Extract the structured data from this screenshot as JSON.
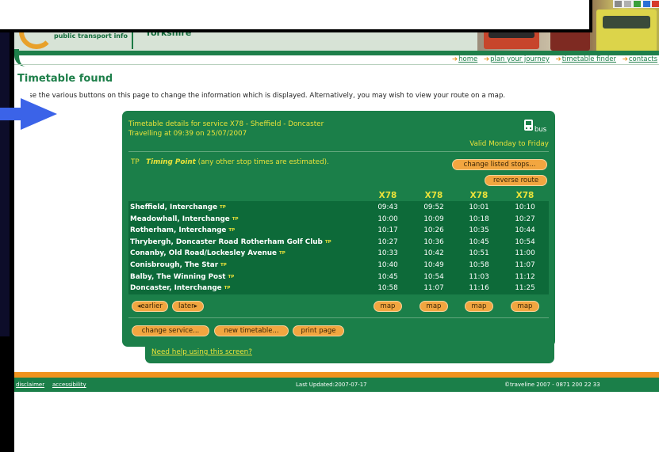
{
  "header": {
    "logo_tagline": "public transport info",
    "region": "Yorkshire"
  },
  "nav": {
    "items": [
      {
        "label": "home"
      },
      {
        "label": "plan your journey"
      },
      {
        "label": "timetable finder"
      },
      {
        "label": "contacts"
      }
    ]
  },
  "page": {
    "title": "Timetable found",
    "intro": "Use the various buttons on this page to change the information which is displayed. Alternatively, you may wish to view your route on a map."
  },
  "timetable": {
    "service_line": "Timetable details for service  X78 - Sheffield - Doncaster",
    "travelling_line": "Travelling at  09:39 on 25/07/2007",
    "mode": "bus",
    "valid": "Valid Monday to Friday",
    "tp_code": "TP",
    "tp_name": "Timing Point",
    "tp_note": "(any other stop times are estimated).",
    "tp_mark": "TP",
    "buttons": {
      "change_stops": "change listed stops...",
      "reverse": "reverse route",
      "earlier": "earlier",
      "later": "later",
      "map": "map",
      "change_service": "change service...",
      "new_timetable": "new timetable...",
      "print": "print page"
    },
    "routes": [
      "X78",
      "X78",
      "X78",
      "X78"
    ],
    "rows": [
      {
        "stop": "Sheffield, Interchange",
        "times": [
          "09:43",
          "09:52",
          "10:01",
          "10:10"
        ]
      },
      {
        "stop": "Meadowhall, Interchange",
        "times": [
          "10:00",
          "10:09",
          "10:18",
          "10:27"
        ]
      },
      {
        "stop": "Rotherham, Interchange",
        "times": [
          "10:17",
          "10:26",
          "10:35",
          "10:44"
        ]
      },
      {
        "stop": "Thrybergh, Doncaster Road Rotherham Golf Club",
        "times": [
          "10:27",
          "10:36",
          "10:45",
          "10:54"
        ]
      },
      {
        "stop": "Conanby, Old Road/Lockesley Avenue",
        "times": [
          "10:33",
          "10:42",
          "10:51",
          "11:00"
        ]
      },
      {
        "stop": "Conisbrough, The Star",
        "times": [
          "10:40",
          "10:49",
          "10:58",
          "11:07"
        ]
      },
      {
        "stop": "Balby, The Winning Post",
        "times": [
          "10:45",
          "10:54",
          "11:03",
          "11:12"
        ]
      },
      {
        "stop": "Doncaster, Interchange",
        "times": [
          "10:58",
          "11:07",
          "11:16",
          "11:25"
        ]
      }
    ],
    "help_link": "Need help using this screen?"
  },
  "footer": {
    "disclaimer": "disclaimer",
    "accessibility": "accessibility",
    "updated": "Last Updated:2007-07-17",
    "copyright": "©traveline 2007 - 0871 200 22 33"
  },
  "colors": {
    "green": "#1b7f49",
    "dark_green": "#0d6a39",
    "yellow_text": "#e9e23a",
    "orange_button": "#f2a640",
    "arrow_blue": "#3b63e8"
  }
}
